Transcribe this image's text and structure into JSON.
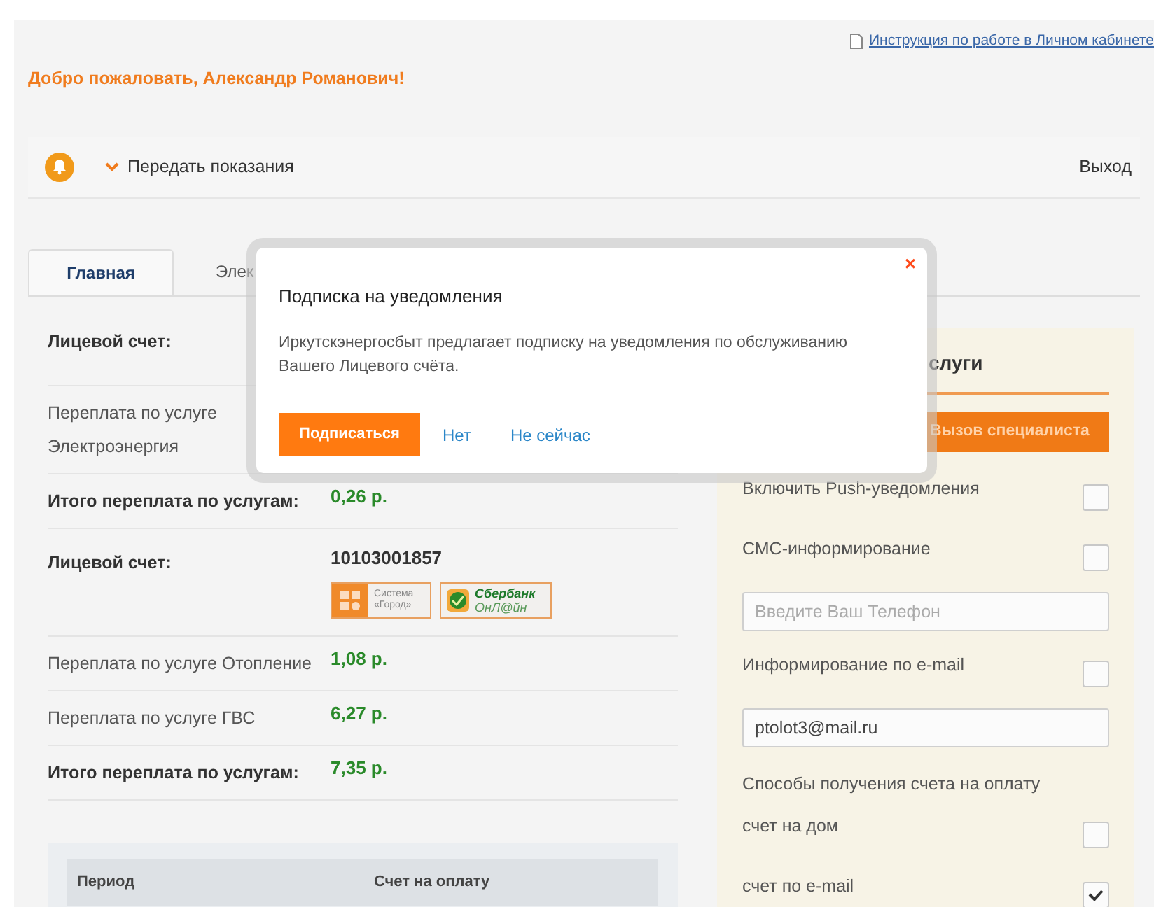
{
  "header": {
    "help_link": "Инструкция по работе в Личном кабинете",
    "welcome": "Добро пожаловать, Александр Романович!"
  },
  "nav": {
    "menu": "Передать показания",
    "logout": "Выход"
  },
  "tabs": [
    {
      "label": "Главная",
      "selected": true
    },
    {
      "label": "Элек",
      "selected": false
    }
  ],
  "rows": [
    {
      "kind": "account",
      "label": "Лицевой счет:"
    },
    {
      "kind": "row",
      "label": "Переплата по услуге Электроэнергия"
    },
    {
      "kind": "total",
      "label": "Итого переплата по услугам:",
      "value": "0,26 р."
    },
    {
      "kind": "account",
      "label": "Лицевой счет:",
      "value": "10103001857",
      "logos": [
        {
          "kind": "city",
          "line1": "Система",
          "line2": "«Город»"
        },
        {
          "kind": "bank",
          "line1": "Сбербанк",
          "line2": "ОнЛ@йн"
        }
      ]
    },
    {
      "kind": "row",
      "label": "Переплата по услуге Отопление",
      "value": "1,08 р."
    },
    {
      "kind": "row",
      "label": "Переплата по услуге ГВС",
      "value": "6,27 р."
    },
    {
      "kind": "total",
      "label": "Итого переплата по услугам:",
      "value": "7,35 р."
    }
  ],
  "table": {
    "columns": [
      "Период",
      "Счет на оплату"
    ]
  },
  "panel": {
    "title": "слуги",
    "button": "Вызов специалиста",
    "items": [
      {
        "kind": "checkbox",
        "label": "Включить Push-уведомления",
        "checked": false
      },
      {
        "kind": "checkbox",
        "label": "СМС-информирование",
        "checked": false
      },
      {
        "kind": "input",
        "placeholder": "Введите Ваш Телефон"
      },
      {
        "kind": "checkbox",
        "label": "Информирование по e-mail",
        "checked": false
      },
      {
        "kind": "input",
        "value": "ptolot3@mail.ru"
      },
      {
        "kind": "text",
        "label": "Способы получения счета на оплату"
      },
      {
        "kind": "checkbox",
        "label": "счет на дом",
        "checked": false
      },
      {
        "kind": "checkbox",
        "label": "счет по e-mail",
        "checked": true
      }
    ]
  },
  "modal": {
    "title": "Подписка на уведомления",
    "body": "Иркутскэнергосбыт предлагает подписку на уведомления по обслуживанию Вашего Лицевого счёта.",
    "subscribe": "Подписаться",
    "no": "Нет",
    "later": "Не сейчас",
    "close": "×"
  }
}
